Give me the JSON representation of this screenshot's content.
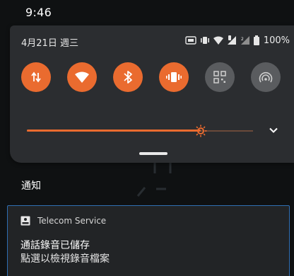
{
  "status_bar": {
    "time": "9:46"
  },
  "quick_settings": {
    "date": "4月21日 週三",
    "battery_percent": "100%",
    "status_icons": [
      "screen-record-icon",
      "vibrate-icon",
      "wifi-icon",
      "signal-icon",
      "signal-roaming-icon",
      "battery-icon"
    ],
    "tiles": [
      {
        "icon": "data-transfer-icon",
        "state": "on"
      },
      {
        "icon": "wifi-icon",
        "state": "on"
      },
      {
        "icon": "bluetooth-icon",
        "state": "on"
      },
      {
        "icon": "vibrate-icon",
        "state": "on"
      },
      {
        "icon": "qr-scan-icon",
        "state": "off"
      },
      {
        "icon": "hotspot-icon",
        "state": "off"
      }
    ],
    "brightness_level": 0.77,
    "colors": {
      "accent": "#ea6b2f",
      "panel": "#2b2d30",
      "tile_off": "#5a5c5f"
    }
  },
  "notifications": {
    "header": "通知",
    "items": [
      {
        "app_icon": "recorder-icon",
        "app_name": "Telecom Service",
        "title": "通話錄音已儲存",
        "text": "點選以檢視錄音檔案",
        "border_color": "#2f6fb3"
      }
    ]
  }
}
